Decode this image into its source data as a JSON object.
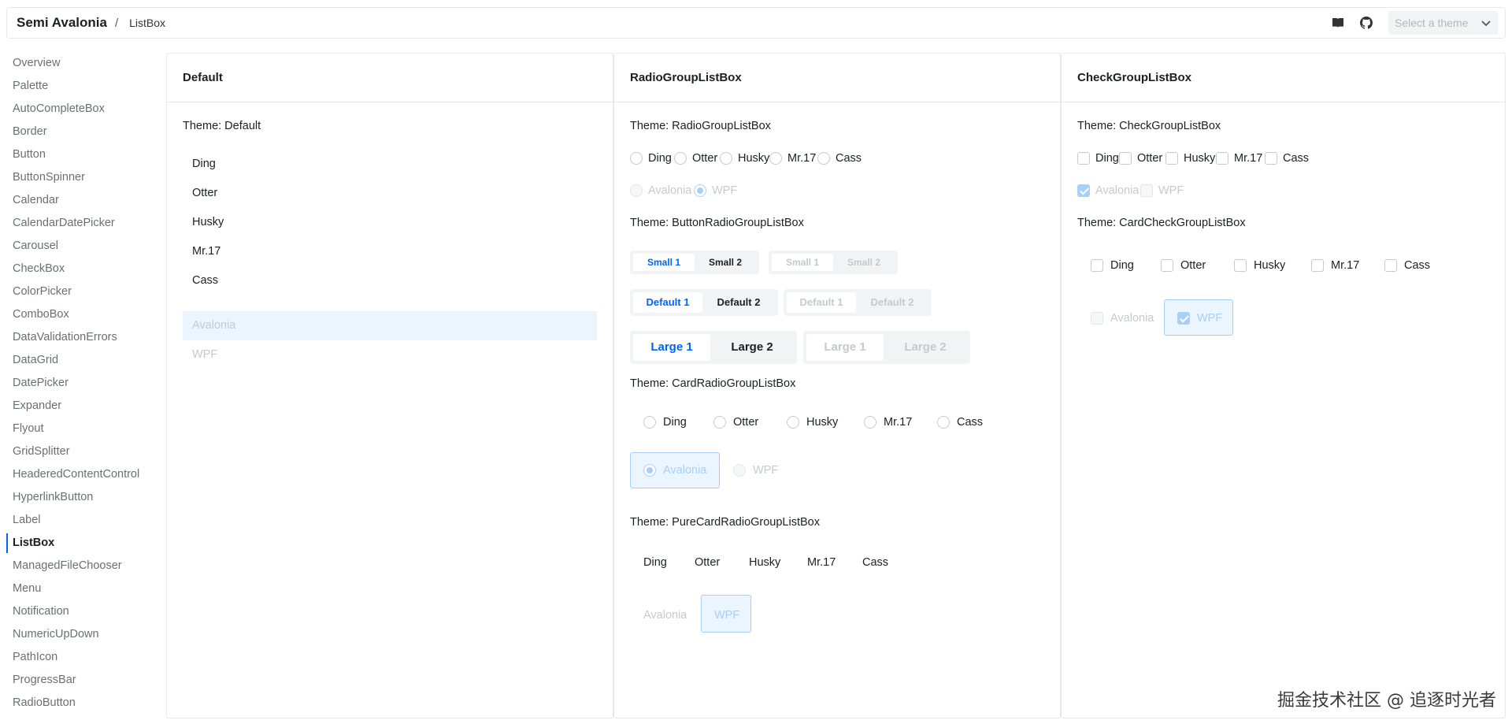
{
  "header": {
    "app_title": "Semi Avalonia",
    "separator": "/",
    "breadcrumb": "ListBox",
    "theme_select_placeholder": "Select a theme"
  },
  "sidebar": {
    "items": [
      "Overview",
      "Palette",
      "AutoCompleteBox",
      "Border",
      "Button",
      "ButtonSpinner",
      "Calendar",
      "CalendarDatePicker",
      "Carousel",
      "CheckBox",
      "ColorPicker",
      "ComboBox",
      "DataValidationErrors",
      "DataGrid",
      "DatePicker",
      "Expander",
      "Flyout",
      "GridSplitter",
      "HeaderedContentControl",
      "HyperlinkButton",
      "Label",
      "ListBox",
      "ManagedFileChooser",
      "Menu",
      "Notification",
      "NumericUpDown",
      "PathIcon",
      "ProgressBar",
      "RadioButton"
    ],
    "active": "ListBox"
  },
  "panels": {
    "default": {
      "title": "Default",
      "theme_label": "Theme: Default",
      "items": [
        "Ding",
        "Otter",
        "Husky",
        "Mr.17",
        "Cass"
      ],
      "disabled_items": [
        "Avalonia",
        "WPF"
      ]
    },
    "radio": {
      "title": "RadioGroupListBox",
      "theme_radio": "Theme: RadioGroupListBox",
      "items": [
        "Ding",
        "Otter",
        "Husky",
        "Mr.17",
        "Cass"
      ],
      "disabled_items": [
        "Avalonia",
        "WPF"
      ],
      "theme_button": "Theme: ButtonRadioGroupListBox",
      "small": [
        "Small 1",
        "Small 2"
      ],
      "default": [
        "Default 1",
        "Default 2"
      ],
      "large": [
        "Large 1",
        "Large 2"
      ],
      "theme_card": "Theme: CardRadioGroupListBox",
      "theme_purecard": "Theme: PureCardRadioGroupListBox"
    },
    "check": {
      "title": "CheckGroupListBox",
      "theme_check": "Theme: CheckGroupListBox",
      "items": [
        "Ding",
        "Otter",
        "Husky",
        "Mr.17",
        "Cass"
      ],
      "disabled_items": [
        "Avalonia",
        "WPF"
      ],
      "theme_card": "Theme: CardCheckGroupListBox"
    }
  },
  "watermark": "掘金技术社区 @ 追逐时光者",
  "colors": {
    "accent": "#0064fa",
    "selected_bg": "#eaf5ff",
    "border": "#e6e8ea"
  }
}
